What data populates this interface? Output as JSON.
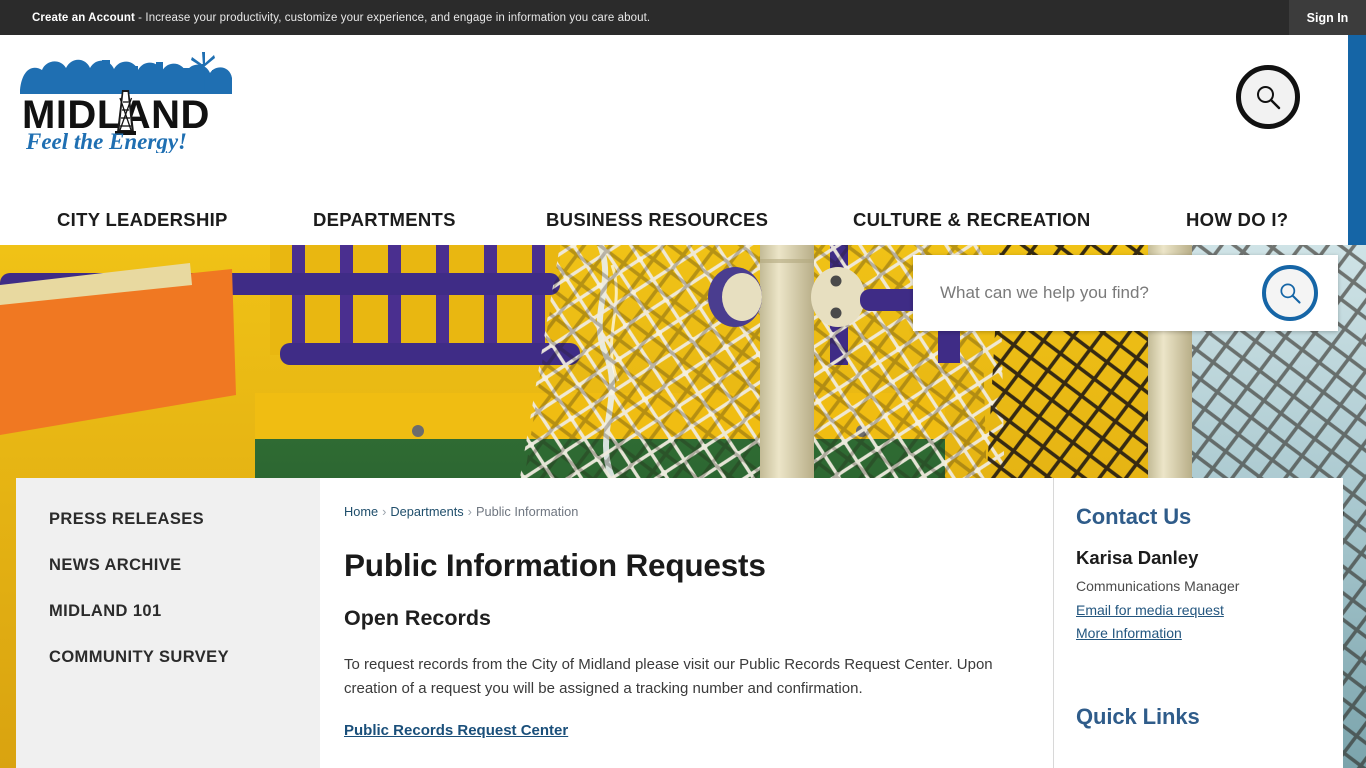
{
  "topbar": {
    "account_cta": "Create an Account",
    "account_message": " - Increase your productivity, customize your experience, and engage in information you care about.",
    "signin_label": "Sign In"
  },
  "header": {
    "logo_wordmark": "MIDLAND",
    "logo_tagline": "Feel the Energy!",
    "accent_color": "#1565a6",
    "nav": [
      {
        "label": "CITY LEADERSHIP"
      },
      {
        "label": "DEPARTMENTS"
      },
      {
        "label": "BUSINESS RESOURCES"
      },
      {
        "label": "CULTURE & RECREATION"
      },
      {
        "label": "HOW DO I?"
      }
    ]
  },
  "hero": {
    "search_placeholder": "What can we help you find?",
    "search_value": ""
  },
  "sidebar": {
    "items": [
      {
        "label": "PRESS RELEASES"
      },
      {
        "label": "NEWS ARCHIVE"
      },
      {
        "label": "MIDLAND 101"
      },
      {
        "label": "COMMUNITY SURVEY"
      }
    ]
  },
  "breadcrumb": {
    "home": "Home",
    "departments": "Departments",
    "current": "Public Information",
    "separator": "›"
  },
  "main": {
    "page_title": "Public Information Requests",
    "section_title": "Open Records",
    "paragraph": "To request records from the City of Midland please visit our Public Records Request Center. Upon creation of a request you will be assigned a tracking number and confirmation.",
    "request_center_link": "Public Records Request Center"
  },
  "right_column": {
    "contact_heading": "Contact Us",
    "contact_name": "Karisa Danley",
    "contact_role": "Communications Manager",
    "email_link": "Email for media request",
    "more_info_link": "More Information",
    "quick_links_heading": "Quick Links"
  }
}
